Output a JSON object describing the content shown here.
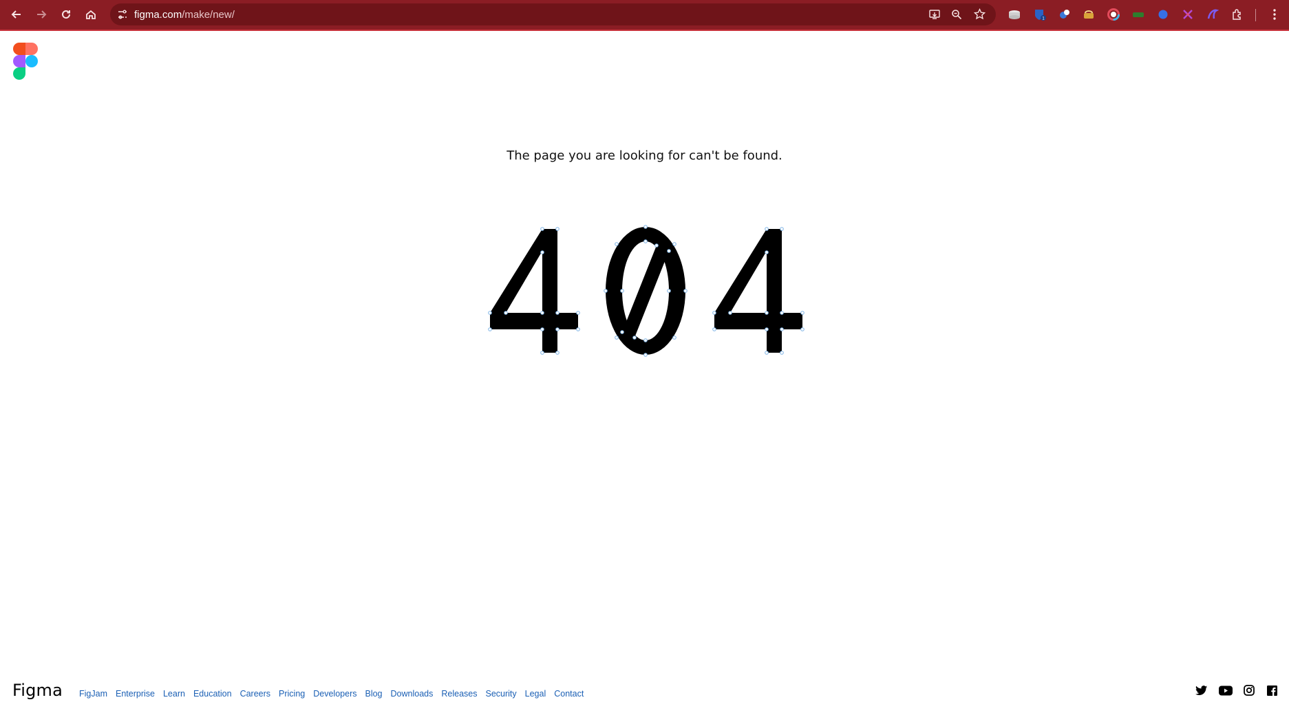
{
  "browser": {
    "url_host": "figma.com",
    "url_path": "/make/new/"
  },
  "page": {
    "message": "The page you are looking for can't be found.",
    "error_code": "404"
  },
  "footer": {
    "brand": "Figma",
    "links": [
      "FigJam",
      "Enterprise",
      "Learn",
      "Education",
      "Careers",
      "Pricing",
      "Developers",
      "Blog",
      "Downloads",
      "Releases",
      "Security",
      "Legal",
      "Contact"
    ],
    "social_icons": [
      "twitter-icon",
      "youtube-icon",
      "instagram-icon",
      "facebook-icon"
    ]
  },
  "colors": {
    "chrome": "#8b1d24",
    "link": "#1a5fb4"
  }
}
